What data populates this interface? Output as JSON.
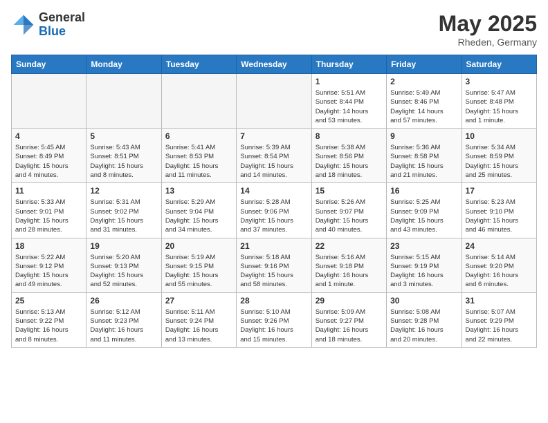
{
  "header": {
    "logo_general": "General",
    "logo_blue": "Blue",
    "month_title": "May 2025",
    "location": "Rheden, Germany"
  },
  "weekdays": [
    "Sunday",
    "Monday",
    "Tuesday",
    "Wednesday",
    "Thursday",
    "Friday",
    "Saturday"
  ],
  "weeks": [
    [
      {
        "day": "",
        "info": ""
      },
      {
        "day": "",
        "info": ""
      },
      {
        "day": "",
        "info": ""
      },
      {
        "day": "",
        "info": ""
      },
      {
        "day": "1",
        "info": "Sunrise: 5:51 AM\nSunset: 8:44 PM\nDaylight: 14 hours\nand 53 minutes."
      },
      {
        "day": "2",
        "info": "Sunrise: 5:49 AM\nSunset: 8:46 PM\nDaylight: 14 hours\nand 57 minutes."
      },
      {
        "day": "3",
        "info": "Sunrise: 5:47 AM\nSunset: 8:48 PM\nDaylight: 15 hours\nand 1 minute."
      }
    ],
    [
      {
        "day": "4",
        "info": "Sunrise: 5:45 AM\nSunset: 8:49 PM\nDaylight: 15 hours\nand 4 minutes."
      },
      {
        "day": "5",
        "info": "Sunrise: 5:43 AM\nSunset: 8:51 PM\nDaylight: 15 hours\nand 8 minutes."
      },
      {
        "day": "6",
        "info": "Sunrise: 5:41 AM\nSunset: 8:53 PM\nDaylight: 15 hours\nand 11 minutes."
      },
      {
        "day": "7",
        "info": "Sunrise: 5:39 AM\nSunset: 8:54 PM\nDaylight: 15 hours\nand 14 minutes."
      },
      {
        "day": "8",
        "info": "Sunrise: 5:38 AM\nSunset: 8:56 PM\nDaylight: 15 hours\nand 18 minutes."
      },
      {
        "day": "9",
        "info": "Sunrise: 5:36 AM\nSunset: 8:58 PM\nDaylight: 15 hours\nand 21 minutes."
      },
      {
        "day": "10",
        "info": "Sunrise: 5:34 AM\nSunset: 8:59 PM\nDaylight: 15 hours\nand 25 minutes."
      }
    ],
    [
      {
        "day": "11",
        "info": "Sunrise: 5:33 AM\nSunset: 9:01 PM\nDaylight: 15 hours\nand 28 minutes."
      },
      {
        "day": "12",
        "info": "Sunrise: 5:31 AM\nSunset: 9:02 PM\nDaylight: 15 hours\nand 31 minutes."
      },
      {
        "day": "13",
        "info": "Sunrise: 5:29 AM\nSunset: 9:04 PM\nDaylight: 15 hours\nand 34 minutes."
      },
      {
        "day": "14",
        "info": "Sunrise: 5:28 AM\nSunset: 9:06 PM\nDaylight: 15 hours\nand 37 minutes."
      },
      {
        "day": "15",
        "info": "Sunrise: 5:26 AM\nSunset: 9:07 PM\nDaylight: 15 hours\nand 40 minutes."
      },
      {
        "day": "16",
        "info": "Sunrise: 5:25 AM\nSunset: 9:09 PM\nDaylight: 15 hours\nand 43 minutes."
      },
      {
        "day": "17",
        "info": "Sunrise: 5:23 AM\nSunset: 9:10 PM\nDaylight: 15 hours\nand 46 minutes."
      }
    ],
    [
      {
        "day": "18",
        "info": "Sunrise: 5:22 AM\nSunset: 9:12 PM\nDaylight: 15 hours\nand 49 minutes."
      },
      {
        "day": "19",
        "info": "Sunrise: 5:20 AM\nSunset: 9:13 PM\nDaylight: 15 hours\nand 52 minutes."
      },
      {
        "day": "20",
        "info": "Sunrise: 5:19 AM\nSunset: 9:15 PM\nDaylight: 15 hours\nand 55 minutes."
      },
      {
        "day": "21",
        "info": "Sunrise: 5:18 AM\nSunset: 9:16 PM\nDaylight: 15 hours\nand 58 minutes."
      },
      {
        "day": "22",
        "info": "Sunrise: 5:16 AM\nSunset: 9:18 PM\nDaylight: 16 hours\nand 1 minute."
      },
      {
        "day": "23",
        "info": "Sunrise: 5:15 AM\nSunset: 9:19 PM\nDaylight: 16 hours\nand 3 minutes."
      },
      {
        "day": "24",
        "info": "Sunrise: 5:14 AM\nSunset: 9:20 PM\nDaylight: 16 hours\nand 6 minutes."
      }
    ],
    [
      {
        "day": "25",
        "info": "Sunrise: 5:13 AM\nSunset: 9:22 PM\nDaylight: 16 hours\nand 8 minutes."
      },
      {
        "day": "26",
        "info": "Sunrise: 5:12 AM\nSunset: 9:23 PM\nDaylight: 16 hours\nand 11 minutes."
      },
      {
        "day": "27",
        "info": "Sunrise: 5:11 AM\nSunset: 9:24 PM\nDaylight: 16 hours\nand 13 minutes."
      },
      {
        "day": "28",
        "info": "Sunrise: 5:10 AM\nSunset: 9:26 PM\nDaylight: 16 hours\nand 15 minutes."
      },
      {
        "day": "29",
        "info": "Sunrise: 5:09 AM\nSunset: 9:27 PM\nDaylight: 16 hours\nand 18 minutes."
      },
      {
        "day": "30",
        "info": "Sunrise: 5:08 AM\nSunset: 9:28 PM\nDaylight: 16 hours\nand 20 minutes."
      },
      {
        "day": "31",
        "info": "Sunrise: 5:07 AM\nSunset: 9:29 PM\nDaylight: 16 hours\nand 22 minutes."
      }
    ]
  ]
}
